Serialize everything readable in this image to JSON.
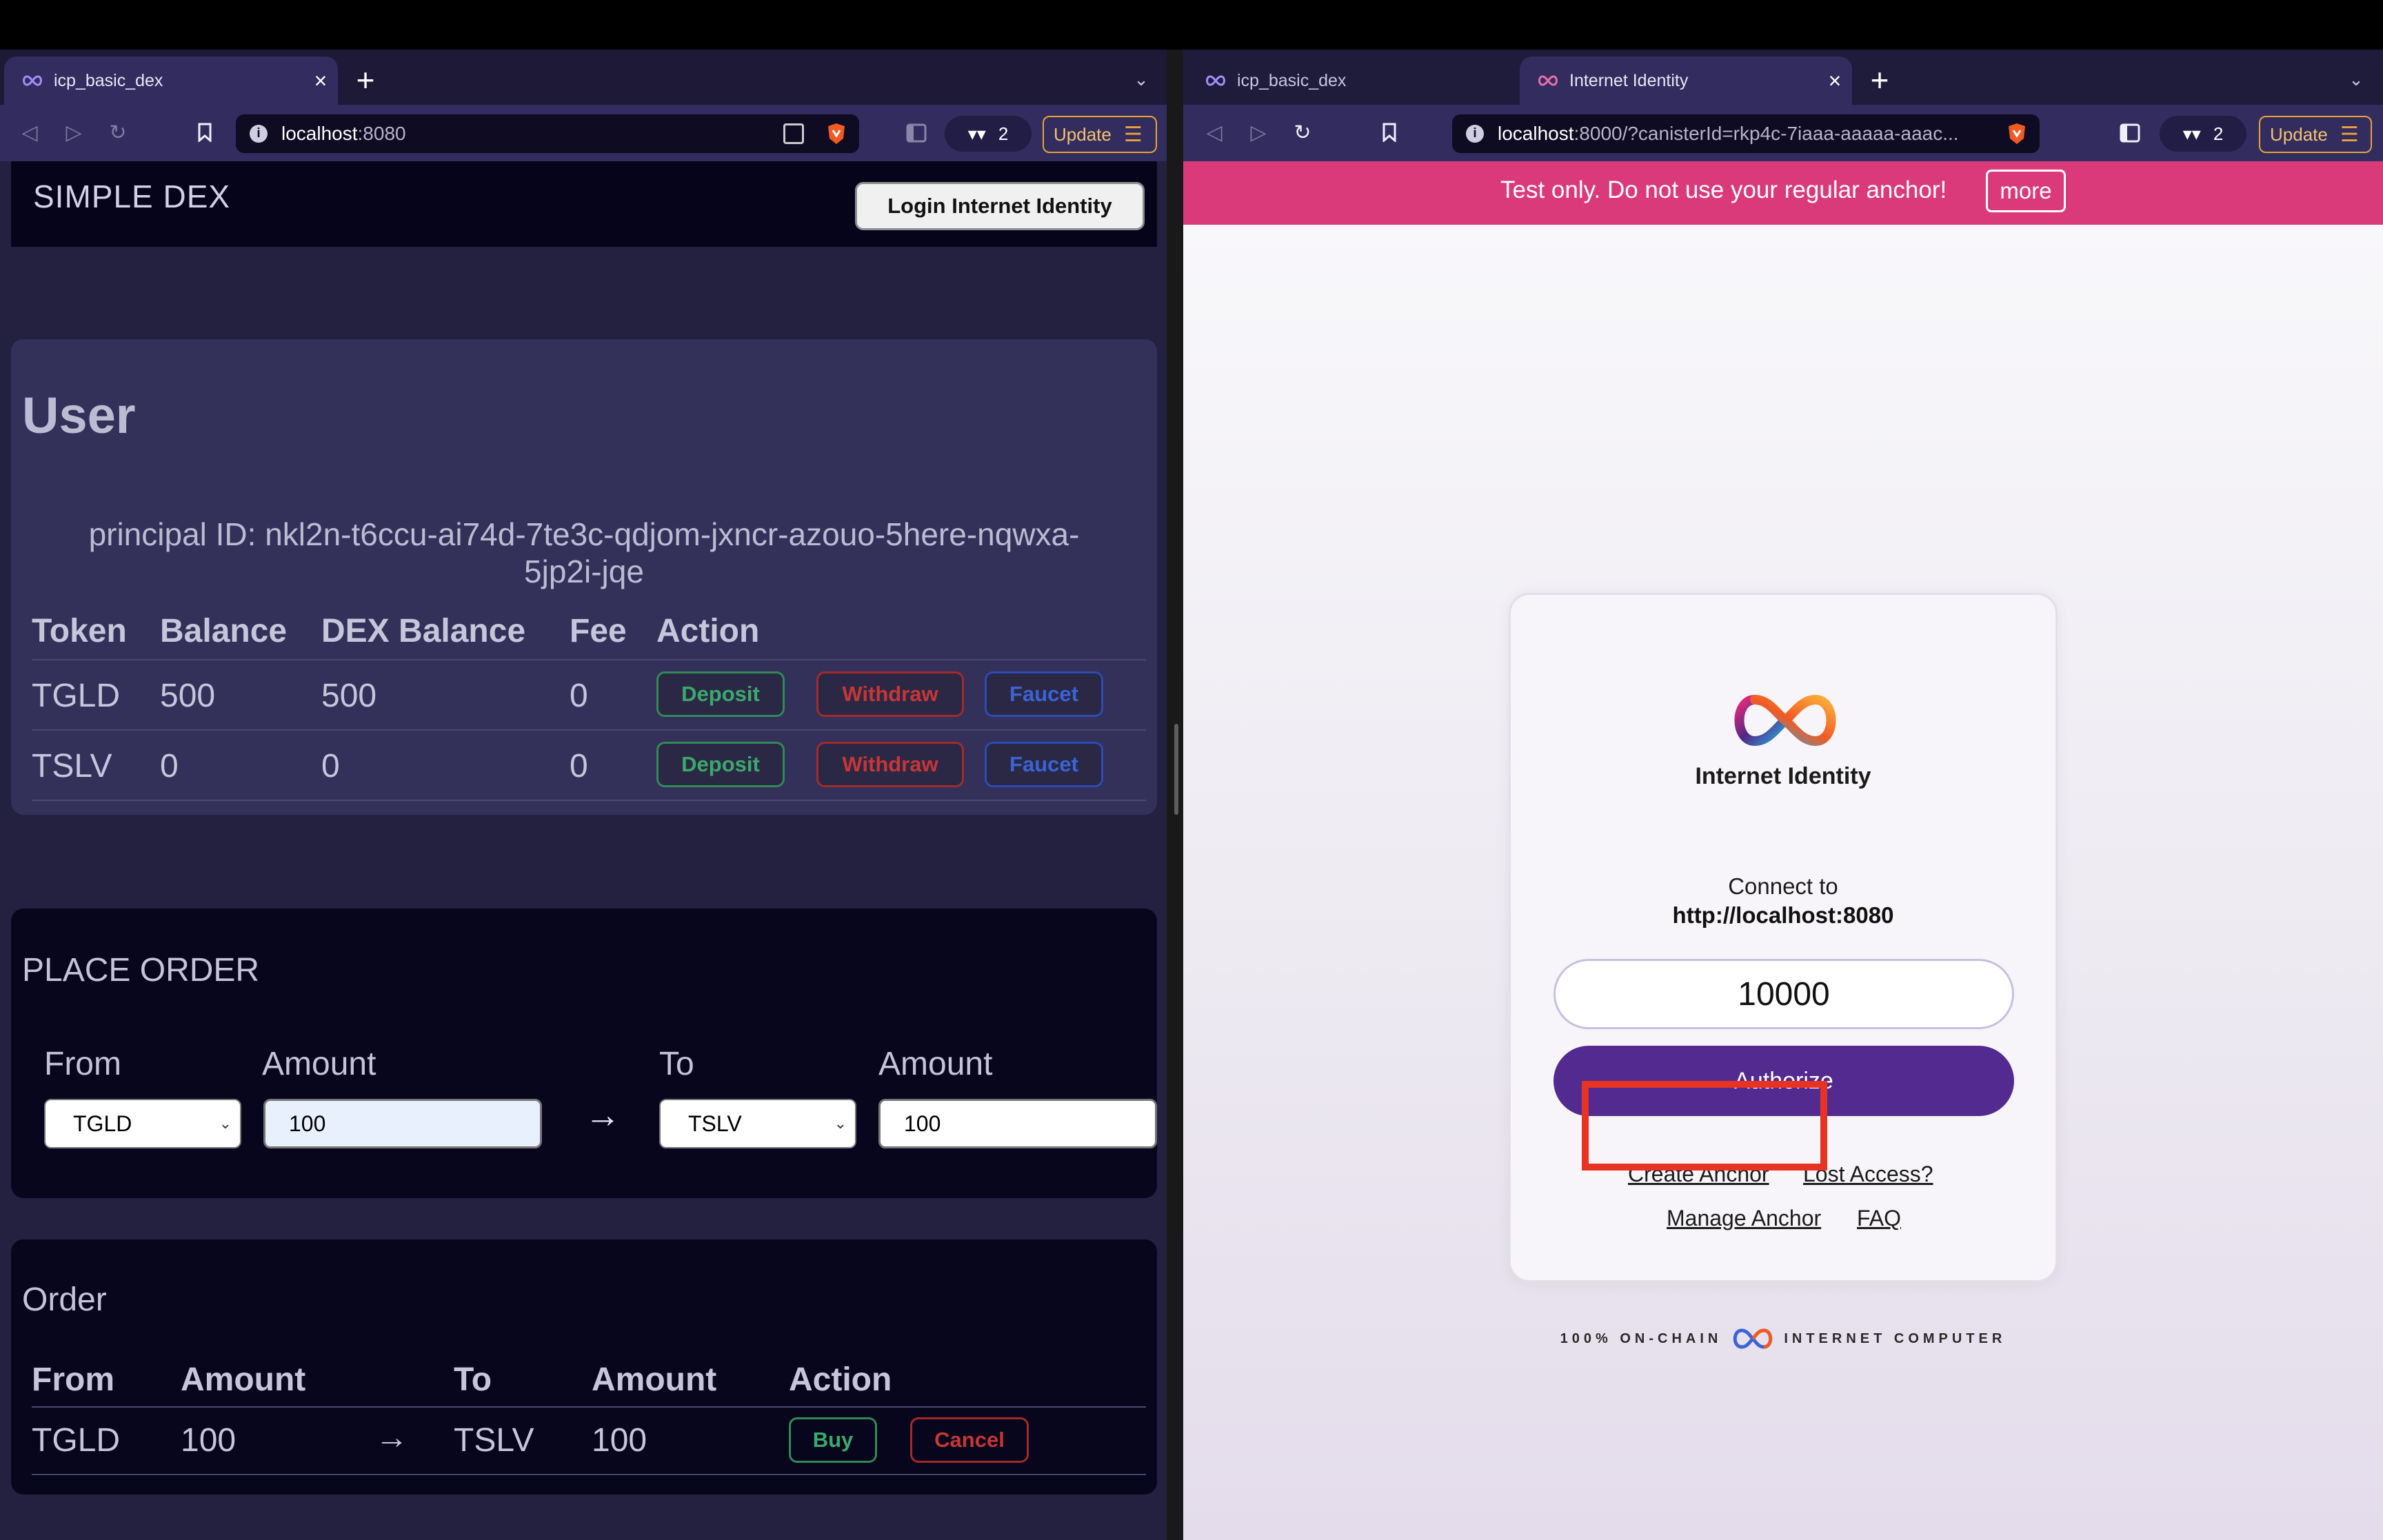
{
  "left_browser": {
    "tab": {
      "title": "icp_basic_dex",
      "close": "×"
    },
    "new_tab": "+",
    "tab_menu": "⌄",
    "url": {
      "host": "localhost",
      "rest": ":8080"
    },
    "badge_count": "2",
    "update_label": "Update"
  },
  "right_browser": {
    "tabs": [
      {
        "title": "icp_basic_dex"
      },
      {
        "title": "Internet Identity",
        "close": "×"
      }
    ],
    "new_tab": "+",
    "tab_menu": "⌄",
    "url": {
      "host": "localhost",
      "rest": ":8000/?canisterId=rkp4c-7iaaa-aaaaa-aaac..."
    },
    "badge_count": "2",
    "update_label": "Update"
  },
  "dex": {
    "title": "SIMPLE DEX",
    "login_label": "Login Internet Identity",
    "user": {
      "title": "User",
      "principal_line1": "principal ID: nkl2n-t6ccu-ai74d-7te3c-qdjom-jxncr-azouo-5here-nqwxa-",
      "principal_line2": "5jp2i-jqe",
      "headers": [
        "Token",
        "Balance",
        "DEX Balance",
        "Fee",
        "Action"
      ],
      "rows": [
        {
          "token": "TGLD",
          "balance": "500",
          "dex_balance": "500",
          "fee": "0"
        },
        {
          "token": "TSLV",
          "balance": "0",
          "dex_balance": "0",
          "fee": "0"
        }
      ],
      "deposit_label": "Deposit",
      "withdraw_label": "Withdraw",
      "faucet_label": "Faucet"
    },
    "place_order": {
      "title": "PLACE ORDER",
      "from_label": "From",
      "amount_label": "Amount",
      "to_label": "To",
      "from_value": "TGLD",
      "from_amount": "100",
      "to_value": "TSLV",
      "to_amount": "100",
      "arrow": "→"
    },
    "order_book": {
      "title": "Order",
      "headers": [
        "From",
        "Amount",
        "To",
        "Amount",
        "Action"
      ],
      "row": {
        "from": "TGLD",
        "amount": "100",
        "arrow": "→",
        "to": "TSLV",
        "to_amount": "100"
      },
      "buy_label": "Buy",
      "cancel_label": "Cancel"
    }
  },
  "ii": {
    "banner_text": "Test only. Do not use your regular anchor!",
    "more_label": "more",
    "name": "Internet Identity",
    "connect_label": "Connect to",
    "connect_host": "http://localhost:8080",
    "anchor_value": "10000",
    "authorize_label": "Authorize",
    "create_anchor": "Create Anchor",
    "lost_access": "Lost Access?",
    "manage_anchor": "Manage Anchor",
    "faq": "FAQ",
    "footer_left": "100% ON-CHAIN",
    "footer_right": "INTERNET COMPUTER"
  },
  "colors": {
    "dex_bg": "#232040",
    "card_user": "#33315a",
    "card_dark": "#07061d",
    "deposit": "#3ba96b",
    "withdraw": "#c63636",
    "faucet": "#3c63d6",
    "ii_purple": "#532a8f",
    "banner_pink": "#db3a7a",
    "highlight_red": "#e63323"
  },
  "icons": [
    "infinity-favicon",
    "back-icon",
    "forward-icon",
    "reload-icon",
    "bookmark-icon",
    "info-icon",
    "qr-icon",
    "brave-shield-icon",
    "sidebar-icon",
    "wallet-icon",
    "menu-icon"
  ]
}
